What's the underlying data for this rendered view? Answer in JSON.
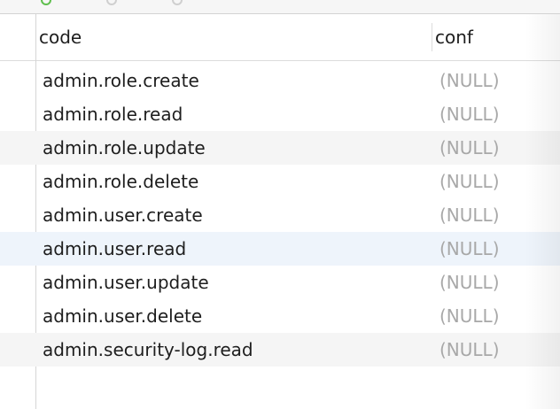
{
  "columns": {
    "code": "code",
    "conf": "conf"
  },
  "rows": [
    {
      "code": "admin.role.create",
      "conf": "(NULL)"
    },
    {
      "code": "admin.role.read",
      "conf": "(NULL)"
    },
    {
      "code": "admin.role.update",
      "conf": "(NULL)"
    },
    {
      "code": "admin.role.delete",
      "conf": "(NULL)"
    },
    {
      "code": "admin.user.create",
      "conf": "(NULL)"
    },
    {
      "code": "admin.user.read",
      "conf": "(NULL)"
    },
    {
      "code": "admin.user.update",
      "conf": "(NULL)"
    },
    {
      "code": "admin.user.delete",
      "conf": "(NULL)"
    },
    {
      "code": "admin.security-log.read",
      "conf": "(NULL)"
    }
  ],
  "colors": {
    "null_text": "#a8a8a8",
    "stripe": "#f5f5f5",
    "selected": "#eef4fb"
  }
}
